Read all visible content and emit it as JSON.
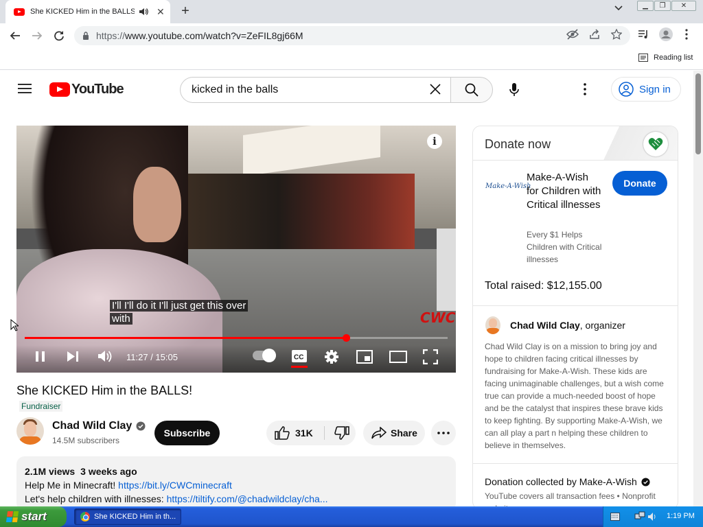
{
  "browser": {
    "tab_title": "She KICKED Him in the BALLS!",
    "new_tab": "+",
    "url_prefix": "https://",
    "url_host": "www.youtube.com",
    "url_path": "/watch?v=ZeFIL8gj66M",
    "reading_list": "Reading list"
  },
  "youtube": {
    "logo_text": "YouTube",
    "search_value": "kicked in the balls",
    "sign_in": "Sign in"
  },
  "player": {
    "caption_line1": "I'll I'll do it I'll just get this over",
    "caption_line2": "with",
    "current_time": "11:27",
    "separator": " / ",
    "duration": "15:05",
    "progress_fraction": 0.759,
    "info": "i",
    "watermark": "CWC"
  },
  "video": {
    "title": "She KICKED Him in the BALLS!",
    "badge": "Fundraiser",
    "channel_name": "Chad Wild Clay",
    "subscribers": "14.5M subscribers",
    "subscribe": "Subscribe",
    "likes": "31K",
    "share": "Share",
    "views": "2.1M views",
    "posted": "3 weeks ago",
    "desc_line1_text": "Help Me in Minecraft! ",
    "desc_line1_link": "https://bit.ly/CWCminecraft",
    "desc_line2_text": "Let's help children with illnesses: ",
    "desc_line2_link": "https://tiltify.com/@chadwildclay/cha..."
  },
  "donate": {
    "header": "Donate now",
    "charity_logo": "Make-A-Wish",
    "charity_name": "Make-A-Wish for Children with Critical illnesses",
    "charity_tagline": "Every $1 Helps Children with Critical illnesses",
    "button": "Donate",
    "total_raised": "Total raised: $12,155.00",
    "organizer_name": "Chad Wild Clay",
    "organizer_role": ", organizer",
    "organizer_text": "Chad Wild Clay is on a mission to bring joy and hope to children facing critical illnesses by fundraising for Make-A-Wish. These kids are facing unimaginable challenges, but a wish come true can provide a much-needed boost of hope and be the catalyst that inspires these brave kids to keep fighting. By supporting Make-A-Wish, we can all play a part n helping these children to believe in themselves.",
    "collected_by": "Donation collected by Make-A-Wish",
    "fees_note": "YouTube covers all transaction fees  •  Nonprofit website"
  },
  "taskbar": {
    "start": "start",
    "task_item": "She KICKED Him in th...",
    "clock": "1:19 PM"
  },
  "colors": {
    "youtube_red": "#ff0000",
    "link_blue": "#065fd4",
    "xp_blue": "#245edb",
    "xp_start_green": "#3c9a3c"
  }
}
